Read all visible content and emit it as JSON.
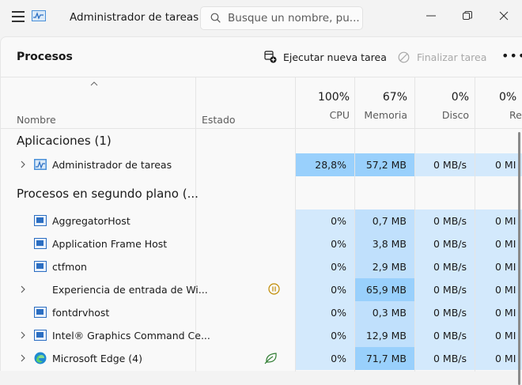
{
  "window": {
    "title": "Administrador de tareas",
    "search_placeholder": "Busque un nombre, pu..."
  },
  "toolbar": {
    "page_title": "Procesos",
    "run_task_label": "Ejecutar nueva tarea",
    "end_task_label": "Finalizar tarea",
    "more_label": "•••"
  },
  "columns": {
    "name": "Nombre",
    "status": "Estado",
    "cpu": {
      "pct": "100%",
      "label": "CPU"
    },
    "memory": {
      "pct": "67%",
      "label": "Memoria"
    },
    "disk": {
      "pct": "0%",
      "label": "Disco"
    },
    "network": {
      "pct": "0%",
      "label": "Re"
    }
  },
  "groups": [
    {
      "title": "Aplicaciones (1)"
    },
    {
      "title": "Procesos en segundo plano (..."
    }
  ],
  "rows": [
    {
      "name": "Administrador de tareas",
      "icon": "task-manager-icon",
      "expandable": true,
      "status": "",
      "cpu": "28,8%",
      "memory": "57,2 MB",
      "disk": "0 MB/s",
      "network": "0 MI"
    },
    {
      "name": "AggregatorHost",
      "icon": "window-icon",
      "expandable": false,
      "status": "",
      "cpu": "0%",
      "memory": "0,7 MB",
      "disk": "0 MB/s",
      "network": "0 MI"
    },
    {
      "name": "Application Frame Host",
      "icon": "window-icon",
      "expandable": false,
      "status": "",
      "cpu": "0%",
      "memory": "3,8 MB",
      "disk": "0 MB/s",
      "network": "0 MI"
    },
    {
      "name": "ctfmon",
      "icon": "window-icon",
      "expandable": false,
      "status": "",
      "cpu": "0%",
      "memory": "2,9 MB",
      "disk": "0 MB/s",
      "network": "0 MI"
    },
    {
      "name": "Experiencia de entrada de Wi...",
      "icon": "",
      "expandable": true,
      "status": "pause-icon",
      "cpu": "0%",
      "memory": "65,9 MB",
      "disk": "0 MB/s",
      "network": "0 MI"
    },
    {
      "name": "fontdrvhost",
      "icon": "window-icon",
      "expandable": false,
      "status": "",
      "cpu": "0%",
      "memory": "0,3 MB",
      "disk": "0 MB/s",
      "network": "0 MI"
    },
    {
      "name": "Intel® Graphics Command Ce...",
      "icon": "window-icon",
      "expandable": true,
      "status": "",
      "cpu": "0%",
      "memory": "12,9 MB",
      "disk": "0 MB/s",
      "network": "0 MI"
    },
    {
      "name": "Microsoft Edge (4)",
      "icon": "edge-icon",
      "expandable": true,
      "status": "leaf-icon",
      "cpu": "0%",
      "memory": "71,7 MB",
      "disk": "0 MB/s",
      "network": "0 MI"
    }
  ],
  "colors": {
    "heat_light": "#d3e9fc",
    "heat_mid": "#c0e0fc",
    "heat_strong": "#99d0fc",
    "accent_blue": "#2b6ec2",
    "status_orange": "#c08a00",
    "status_green": "#2f7d32"
  }
}
